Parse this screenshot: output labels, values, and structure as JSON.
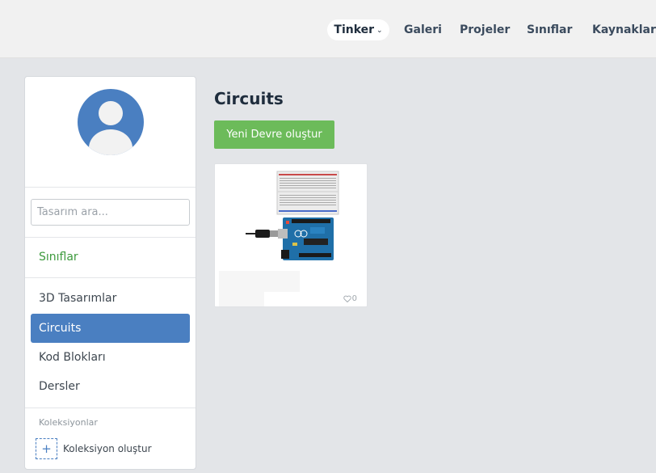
{
  "nav": {
    "tinker": "Tinker",
    "galeri": "Galeri",
    "projeler": "Projeler",
    "siniflar": "Sınıflar",
    "kaynaklar": "Kaynaklar"
  },
  "sidebar": {
    "search_placeholder": "Tasarım ara...",
    "classes_link": "Sınıflar",
    "items": [
      {
        "label": "3D Tasarımlar"
      },
      {
        "label": "Circuits"
      },
      {
        "label": "Kod Blokları"
      },
      {
        "label": "Dersler"
      }
    ],
    "collections_label": "Koleksiyonlar",
    "create_collection": "Koleksiyon oluştur"
  },
  "main": {
    "title": "Circuits",
    "new_button": "Yeni Devre oluştur",
    "designs": [
      {
        "likes": "0"
      }
    ]
  },
  "colors": {
    "accent_blue": "#4a7fc1",
    "button_green": "#6cbb5a",
    "link_green": "#3d9a3d"
  }
}
